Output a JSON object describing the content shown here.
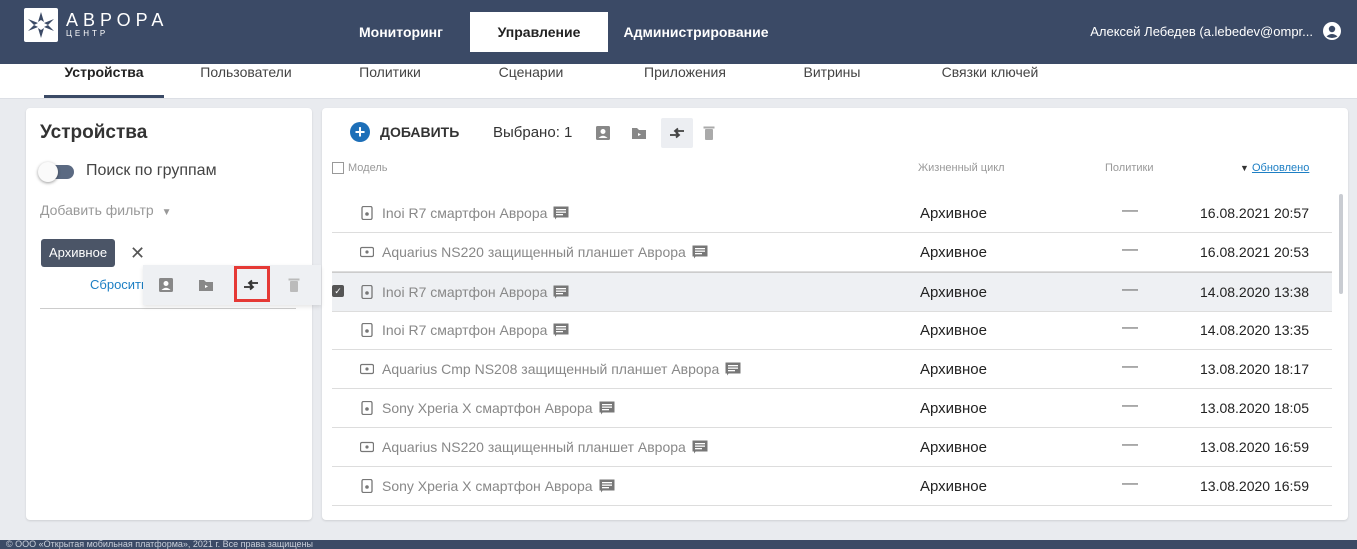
{
  "brand": {
    "title": "АВРОРА",
    "subtitle": "ЦЕНТР"
  },
  "main_nav": [
    {
      "label": "Мониторинг",
      "active": false
    },
    {
      "label": "Управление",
      "active": true
    },
    {
      "label": "Администрирование",
      "active": false
    }
  ],
  "user": {
    "name": "Алексей Лебедев (a.lebedev@ompr..."
  },
  "sub_nav": [
    {
      "label": "Устройства",
      "active": true
    },
    {
      "label": "Пользователи",
      "active": false
    },
    {
      "label": "Политики",
      "active": false
    },
    {
      "label": "Сценарии",
      "active": false
    },
    {
      "label": "Приложения",
      "active": false
    },
    {
      "label": "Витрины",
      "active": false
    },
    {
      "label": "Связки ключей",
      "active": false
    }
  ],
  "filters": {
    "title": "Устройства",
    "group_search_label": "Поиск по группам",
    "group_search_on": false,
    "add_filter_label": "Добавить фильтр",
    "chip_label": "Архивное",
    "reset_label": "Сбросить"
  },
  "toolbar": {
    "add_label": "ДОБАВИТЬ",
    "selected_label": "Выбрано: 1",
    "icons": [
      "assign-user-icon",
      "move-to-folder-icon",
      "transfer-icon",
      "delete-icon"
    ]
  },
  "table": {
    "headers": {
      "model": "Модель",
      "lifecycle": "Жизненный цикл",
      "policies": "Политики",
      "updated": "Обновлено"
    },
    "rows": [
      {
        "model": "Inoi R7 смартфон Аврора",
        "device": "phone",
        "lifecycle": "Архивное",
        "policies": "—",
        "updated": "16.08.2021 20:57",
        "selected": false
      },
      {
        "model": "Aquarius NS220 защищенный планшет Аврора",
        "device": "tablet",
        "lifecycle": "Архивное",
        "policies": "—",
        "updated": "16.08.2021 20:53",
        "selected": false
      },
      {
        "model": "Inoi R7 смартфон Аврора",
        "device": "phone",
        "lifecycle": "Архивное",
        "policies": "—",
        "updated": "14.08.2020 13:38",
        "selected": true
      },
      {
        "model": "Inoi R7 смартфон Аврора",
        "device": "phone",
        "lifecycle": "Архивное",
        "policies": "—",
        "updated": "14.08.2020 13:35",
        "selected": false
      },
      {
        "model": "Aquarius Cmp NS208 защищенный планшет Аврора",
        "device": "tablet",
        "lifecycle": "Архивное",
        "policies": "—",
        "updated": "13.08.2020 18:17",
        "selected": false
      },
      {
        "model": "Sony Xperia X смартфон Аврора",
        "device": "phone",
        "lifecycle": "Архивное",
        "policies": "—",
        "updated": "13.08.2020 18:05",
        "selected": false
      },
      {
        "model": "Aquarius NS220 защищенный планшет Аврора",
        "device": "tablet",
        "lifecycle": "Архивное",
        "policies": "—",
        "updated": "13.08.2020 16:59",
        "selected": false
      },
      {
        "model": "Sony Xperia X смартфон Аврора",
        "device": "phone",
        "lifecycle": "Архивное",
        "policies": "—",
        "updated": "13.08.2020 16:59",
        "selected": false
      }
    ]
  },
  "footer": {
    "text": "© ООО «Открытая мобильная платформа», 2021 г. Все права защищены"
  },
  "colors": {
    "header_bg": "#3b4a66",
    "accent": "#1d6fb8",
    "link": "#1d7fc4",
    "highlight": "#e53935"
  }
}
